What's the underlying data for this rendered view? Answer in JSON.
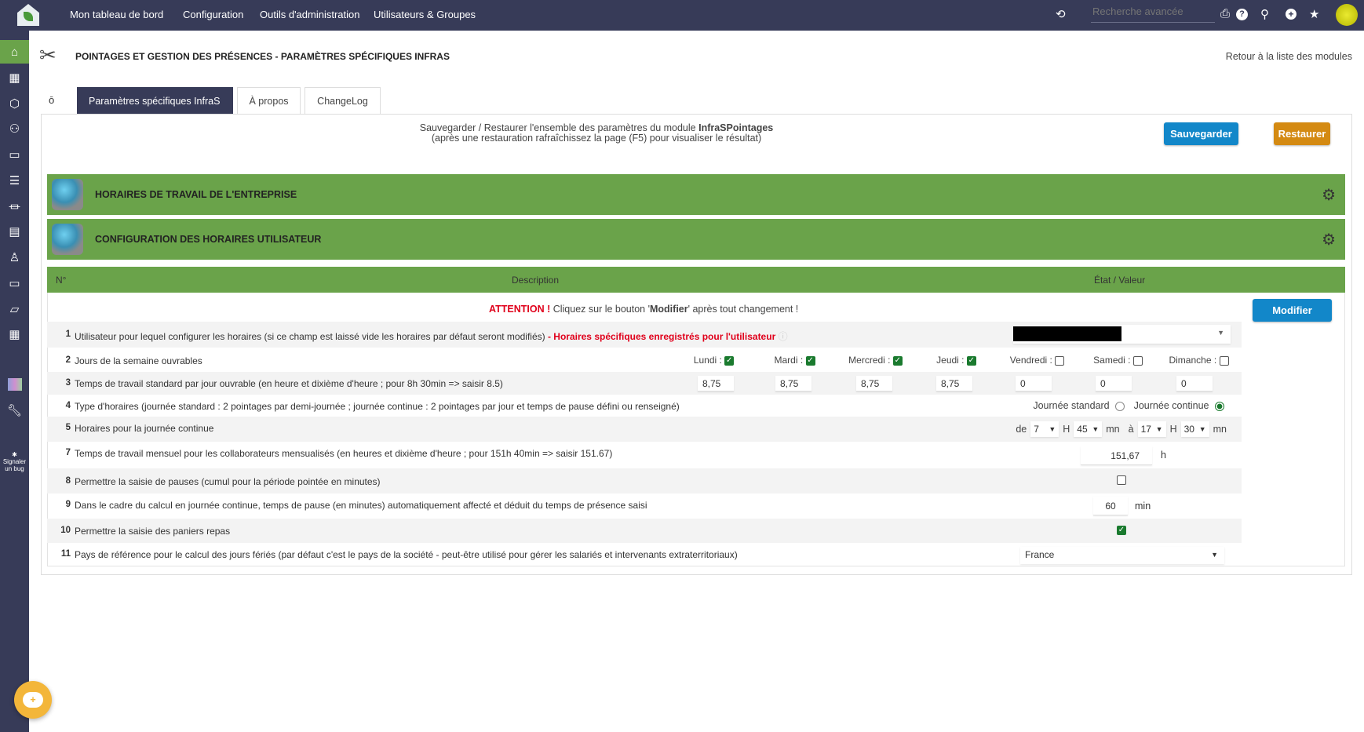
{
  "topbar": {
    "nav": [
      "Mon tableau de bord",
      "Configuration",
      "Outils d'administration",
      "Utilisateurs & Groupes"
    ],
    "search_placeholder": "Recherche avancée"
  },
  "sidebar": {
    "bug_label_1": "Signaler",
    "bug_label_2": "un bug"
  },
  "page": {
    "title": "POINTAGES ET GESTION DES PRÉSENCES - PARAMÈTRES SPÉCIFIQUES INFRAS",
    "back_link": "Retour à la liste des modules"
  },
  "tabs": [
    {
      "label": "Paramètres spécifiques InfraS"
    },
    {
      "label": "À propos"
    },
    {
      "label": "ChangeLog"
    }
  ],
  "backup": {
    "line1_prefix": "Sauvegarder / Restaurer l'ensemble des paramètres du module ",
    "module": "InfraSPointages",
    "line2": "(après une restauration rafraîchissez la page (F5) pour visualiser le résultat)",
    "save": "Sauvegarder",
    "restore": "Restaurer"
  },
  "sections": [
    "HORAIRES DE TRAVAIL DE L'ENTREPRISE",
    "CONFIGURATION DES HORAIRES UTILISATEUR"
  ],
  "table": {
    "headers": [
      "N°",
      "Description",
      "État / Valeur"
    ],
    "attention_label": "ATTENTION !",
    "attention_text_1": " Cliquez sur le bouton '",
    "attention_bold": "Modifier",
    "attention_text_2": "' après tout changement !",
    "modify": "Modifier",
    "rows": [
      {
        "n": "1",
        "desc": "Utilisateur pour lequel configurer les horaires (si ce champ est laissé vide les horaires par défaut seront modifiés)",
        "note": " - Horaires spécifiques enregistrés pour l'utilisateur"
      },
      {
        "n": "2",
        "desc": "Jours de la semaine ouvrables"
      },
      {
        "n": "3",
        "desc": "Temps de travail standard par jour ouvrable (en heure et dixième d'heure ; pour 8h 30min => saisir 8.5)"
      },
      {
        "n": "4",
        "desc": "Type d'horaires (journée standard : 2 pointages par demi-journée ; journée continue : 2 pointages par jour et temps de pause défini ou renseigné)"
      },
      {
        "n": "5",
        "desc": "Horaires pour la journée continue"
      },
      {
        "n": "7",
        "desc": "Temps de travail mensuel pour les collaborateurs mensualisés (en heures et dixième d'heure ; pour 151h 40min => saisir 151.67)"
      },
      {
        "n": "8",
        "desc": "Permettre la saisie de pauses (cumul pour la période pointée en minutes)"
      },
      {
        "n": "9",
        "desc": "Dans le cadre du calcul en journée continue, temps de pause (en minutes) automatiquement affecté et déduit du temps de présence saisi"
      },
      {
        "n": "10",
        "desc": "Permettre la saisie des paniers repas"
      },
      {
        "n": "11",
        "desc": "Pays de référence pour le calcul des jours fériés (par défaut c'est le pays de la société - peut-être utilisé pour gérer les salariés et intervenants extraterritoriaux)"
      }
    ]
  },
  "days": [
    {
      "label": "Lundi :",
      "checked": true,
      "hours": "8,75"
    },
    {
      "label": "Mardi :",
      "checked": true,
      "hours": "8,75"
    },
    {
      "label": "Mercredi :",
      "checked": true,
      "hours": "8,75"
    },
    {
      "label": "Jeudi :",
      "checked": true,
      "hours": "8,75"
    },
    {
      "label": "Vendredi :",
      "checked": false,
      "hours": "0"
    },
    {
      "label": "Samedi :",
      "checked": false,
      "hours": "0"
    },
    {
      "label": "Dimanche :",
      "checked": false,
      "hours": "0"
    }
  ],
  "schedule_type": {
    "standard": "Journée standard",
    "continue": "Journée continue",
    "selected": "continue"
  },
  "continuous": {
    "de": "de",
    "start_h": "7",
    "h": "H",
    "start_m": "45",
    "mn": "mn",
    "a": "à",
    "end_h": "17",
    "end_m": "30"
  },
  "monthly": {
    "value": "151,67",
    "unit": "h"
  },
  "pause_enabled": false,
  "pause": {
    "value": "60",
    "unit": "min"
  },
  "meal_enabled": true,
  "country": "France",
  "colors": {
    "nav_bg": "#373b58",
    "green": "#6aa34a",
    "blue": "#1287c9",
    "orange": "#d48a12",
    "red": "#e0001b"
  }
}
